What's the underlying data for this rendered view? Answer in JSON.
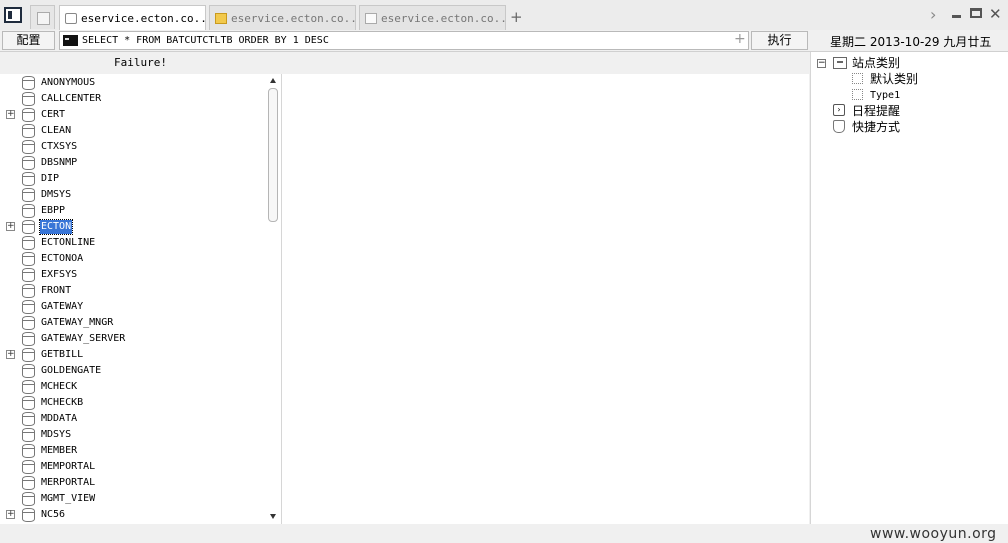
{
  "tabs": [
    {
      "label": "eservice.ecton.co...",
      "icon": "page-icon",
      "active": true
    },
    {
      "label": "eservice.ecton.co...",
      "icon": "folder-icon",
      "active": false
    },
    {
      "label": "eservice.ecton.co...",
      "icon": "document-icon",
      "active": false
    }
  ],
  "toolbar": {
    "config_label": "配置",
    "sql_value": "SELECT * FROM BATCUTCTLTB ORDER BY 1 DESC",
    "run_label": "执行",
    "date_text": "星期二 2013-10-29 九月廿五"
  },
  "left_panel": {
    "status": "Failure!",
    "schemas": [
      {
        "name": "ANONYMOUS",
        "expandable": false
      },
      {
        "name": "CALLCENTER",
        "expandable": false
      },
      {
        "name": "CERT",
        "expandable": true
      },
      {
        "name": "CLEAN",
        "expandable": false
      },
      {
        "name": "CTXSYS",
        "expandable": false
      },
      {
        "name": "DBSNMP",
        "expandable": false
      },
      {
        "name": "DIP",
        "expandable": false
      },
      {
        "name": "DMSYS",
        "expandable": false
      },
      {
        "name": "EBPP",
        "expandable": false
      },
      {
        "name": "ECTON",
        "expandable": true,
        "selected": true
      },
      {
        "name": "ECTONLINE",
        "expandable": false
      },
      {
        "name": "ECTONOA",
        "expandable": false
      },
      {
        "name": "EXFSYS",
        "expandable": false
      },
      {
        "name": "FRONT",
        "expandable": false
      },
      {
        "name": "GATEWAY",
        "expandable": false
      },
      {
        "name": "GATEWAY_MNGR",
        "expandable": false
      },
      {
        "name": "GATEWAY_SERVER",
        "expandable": false
      },
      {
        "name": "GETBILL",
        "expandable": true
      },
      {
        "name": "GOLDENGATE",
        "expandable": false
      },
      {
        "name": "MCHECK",
        "expandable": false
      },
      {
        "name": "MCHECKB",
        "expandable": false
      },
      {
        "name": "MDDATA",
        "expandable": false
      },
      {
        "name": "MDSYS",
        "expandable": false
      },
      {
        "name": "MEMBER",
        "expandable": false
      },
      {
        "name": "MEMPORTAL",
        "expandable": false
      },
      {
        "name": "MERPORTAL",
        "expandable": false
      },
      {
        "name": "MGMT_VIEW",
        "expandable": false
      },
      {
        "name": "NC56",
        "expandable": true
      }
    ]
  },
  "right_panel": {
    "category_label": "站点类别",
    "sub_items": [
      "默认类别",
      "Type1"
    ],
    "schedule_label": "日程提醒",
    "shortcut_label": "快捷方式"
  },
  "watermark": "www.wooyun.org",
  "colors": {
    "selection": "#3875d7",
    "folder": "#f2c94c"
  }
}
